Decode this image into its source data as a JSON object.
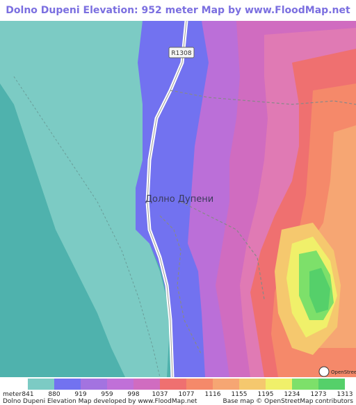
{
  "title": "Dolno Dupeni Elevation: 952 meter Map by www.FloodMap.net (beta)",
  "map": {
    "road_label": "R1308",
    "place_label": "Долно Дупени",
    "osm_logo_text": "OpenStreetMap",
    "colors": {
      "lake": "#4fb2ad",
      "shore": "#7ccbc4",
      "low": "#7272f0",
      "lilac": "#bb6fd8",
      "pink": "#d06cc0",
      "rose": "#e07ab4",
      "red": "#ef7070",
      "orange": "#f5896a",
      "peach": "#f6a673",
      "sand": "#f5c86e",
      "yellow": "#f0f06a",
      "lime": "#7de06a",
      "green": "#55d06a"
    }
  },
  "legend": {
    "unit": "meter",
    "values": [
      "841",
      "880",
      "919",
      "959",
      "998",
      "1037",
      "1077",
      "1116",
      "1155",
      "1195",
      "1234",
      "1273",
      "1313"
    ],
    "colors": [
      "#7ccbc4",
      "#7272f0",
      "#a373e0",
      "#c070d8",
      "#d06cc0",
      "#ef7070",
      "#f5896a",
      "#f6a673",
      "#f5c86e",
      "#f0f06a",
      "#7de06a",
      "#55d06a"
    ]
  },
  "footer": {
    "left": "Dolno Dupeni Elevation Map developed by www.FloodMap.net",
    "right": "Base map © OpenStreetMap contributors"
  }
}
